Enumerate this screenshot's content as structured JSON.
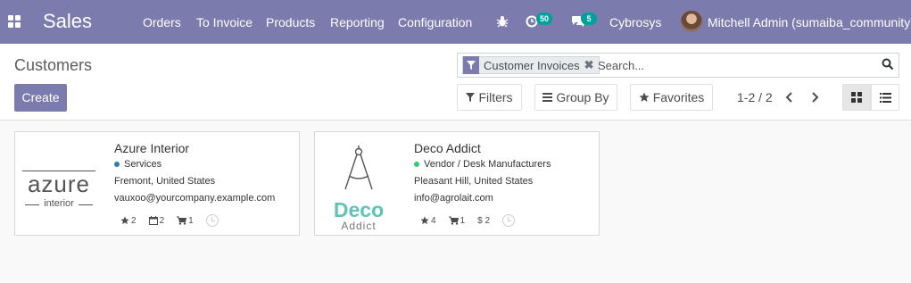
{
  "navbar": {
    "app_name": "Sales",
    "menu": [
      "Orders",
      "To Invoice",
      "Products",
      "Reporting",
      "Configuration"
    ],
    "activity_count": "50",
    "messages_count": "5",
    "company": "Cybrosys",
    "user": "Mitchell Admin (sumaiba_community)"
  },
  "control_panel": {
    "title": "Customers",
    "create_label": "Create",
    "search": {
      "facet_value": "Customer Invoices",
      "placeholder": "Search..."
    },
    "filters_label": "Filters",
    "group_by_label": "Group By",
    "favorites_label": "Favorites",
    "pager": "1-2 / 2"
  },
  "cards": [
    {
      "name": "Azure Interior",
      "tag": "Services",
      "tag_color": "#337ab7",
      "address": "Fremont, United States",
      "email": "vauxoo@yourcompany.example.com",
      "stats": [
        "2",
        "2",
        "1"
      ],
      "logo_word": "azure",
      "logo_sub": "interior"
    },
    {
      "name": "Deco Addict",
      "tag": "Vendor / Desk Manufacturers",
      "tag_color": "#2ecc71",
      "address": "Pleasant Hill, United States",
      "email": "info@agrolait.com",
      "stats": [
        "4",
        "1",
        "$ 2"
      ],
      "logo_word": "Deco",
      "logo_sub": "Addict"
    }
  ],
  "colors": {
    "brand": "#7c7bad",
    "badge": "#00a09d"
  }
}
